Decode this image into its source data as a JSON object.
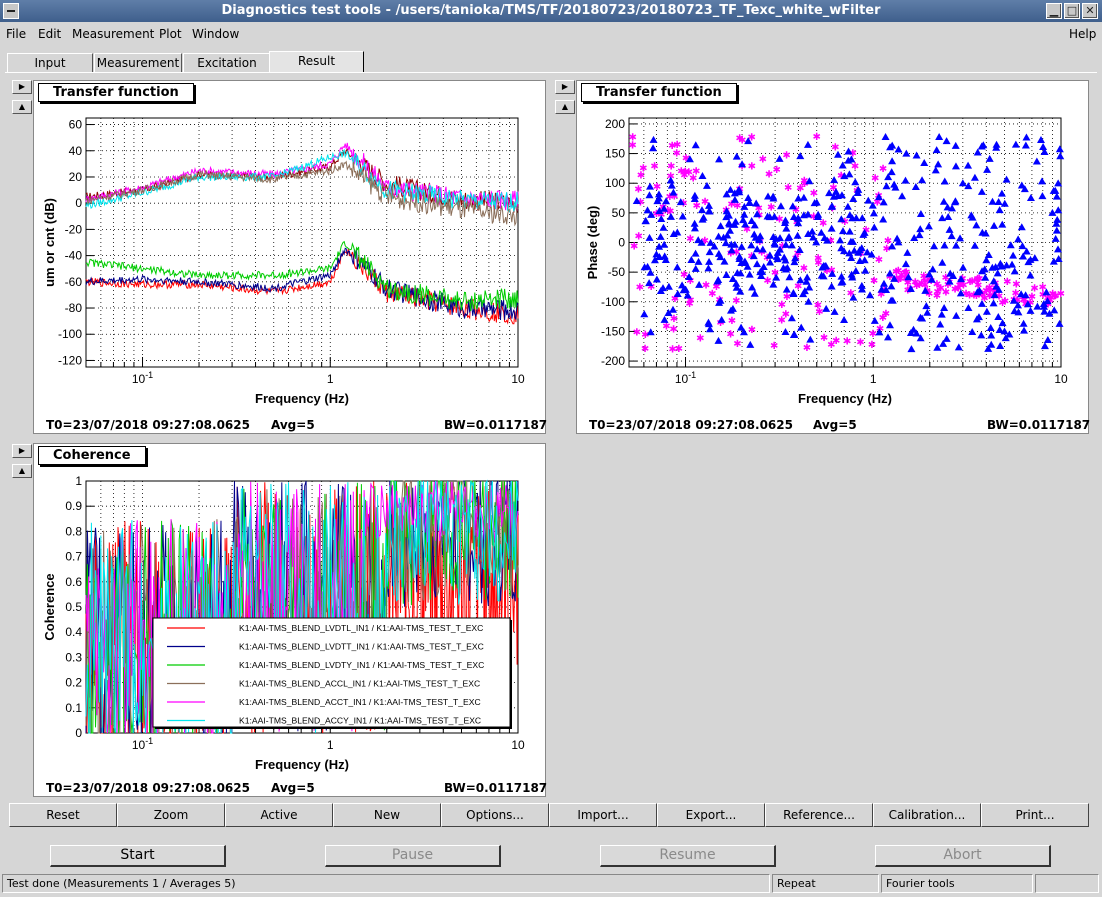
{
  "window": {
    "title": "Diagnostics test tools - /users/tanioka/TMS/TF/20180723/20180723_TF_Texc_white_wFilter"
  },
  "menu": [
    {
      "label": "File"
    },
    {
      "label": "Edit"
    },
    {
      "label": "Measurement"
    },
    {
      "label": "Plot"
    },
    {
      "label": "Window"
    },
    {
      "label": "Help"
    }
  ],
  "tabs": [
    {
      "label": "Input"
    },
    {
      "label": "Measurement"
    },
    {
      "label": "Excitation"
    },
    {
      "label": "Result",
      "active": true
    }
  ],
  "plots": {
    "tf_mag": {
      "title": "Transfer function",
      "t0": "T0=23/07/2018 09:27:08.0625",
      "avg": "Avg=5",
      "bw": "BW=0.0117187"
    },
    "tf_phase": {
      "title": "Transfer function",
      "t0": "T0=23/07/2018 09:27:08.0625",
      "avg": "Avg=5",
      "bw": "BW=0.0117187"
    },
    "coherence": {
      "title": "Coherence",
      "t0": "T0=23/07/2018 09:27:08.0625",
      "avg": "Avg=5",
      "bw": "BW=0.0117187"
    }
  },
  "chart_data": [
    {
      "type": "line",
      "title": "Transfer function",
      "xlabel": "Frequency (Hz)",
      "ylabel": "um or cnt (dB)",
      "xscale": "log",
      "xlim": [
        0.05,
        10
      ],
      "ylim": [
        -125,
        65
      ],
      "xticks": [
        "10^-1",
        "1",
        "10"
      ],
      "yticks": [
        60,
        40,
        20,
        0,
        -20,
        -40,
        -60,
        -80,
        -100,
        -120
      ],
      "grid": true,
      "series": [
        {
          "color": "#8b0000",
          "x": [
            0.05,
            0.1,
            0.2,
            0.5,
            1,
            1.2,
            2,
            5,
            10
          ],
          "y": [
            5,
            10,
            22,
            20,
            28,
            40,
            15,
            3,
            0
          ]
        },
        {
          "color": "#ff00ff",
          "x": [
            0.05,
            0.1,
            0.2,
            0.5,
            1,
            1.2,
            2,
            5,
            10
          ],
          "y": [
            3,
            12,
            25,
            22,
            30,
            45,
            12,
            4,
            2
          ]
        },
        {
          "color": "#00e5ee",
          "x": [
            0.05,
            0.1,
            0.2,
            0.5,
            1,
            1.2,
            2,
            5,
            10
          ],
          "y": [
            -2,
            8,
            20,
            20,
            35,
            38,
            10,
            2,
            1
          ]
        },
        {
          "color": "#8b6f5a",
          "x": [
            0.05,
            0.1,
            0.2,
            0.5,
            1,
            1.2,
            2,
            5,
            10
          ],
          "y": [
            2,
            10,
            22,
            18,
            25,
            30,
            5,
            -5,
            -10
          ]
        },
        {
          "color": "#ff0000",
          "x": [
            0.05,
            0.1,
            0.2,
            0.5,
            1,
            1.2,
            2,
            5,
            10
          ],
          "y": [
            -60,
            -62,
            -62,
            -68,
            -60,
            -35,
            -68,
            -80,
            -85
          ]
        },
        {
          "color": "#00008b",
          "x": [
            0.05,
            0.1,
            0.2,
            0.5,
            1,
            1.2,
            2,
            5,
            10
          ],
          "y": [
            -60,
            -58,
            -60,
            -65,
            -55,
            -35,
            -65,
            -80,
            -82
          ]
        },
        {
          "color": "#00cc00",
          "x": [
            0.05,
            0.1,
            0.2,
            0.5,
            1,
            1.2,
            2,
            5,
            10
          ],
          "y": [
            -45,
            -50,
            -55,
            -55,
            -50,
            -30,
            -65,
            -75,
            -72
          ]
        }
      ]
    },
    {
      "type": "scatter",
      "title": "Transfer function",
      "xlabel": "Frequency (Hz)",
      "ylabel": "Phase (deg)",
      "xscale": "log",
      "xlim": [
        0.05,
        10
      ],
      "ylim": [
        -210,
        210
      ],
      "xticks": [
        "10^-1",
        "1",
        "10"
      ],
      "yticks": [
        200,
        150,
        100,
        50,
        0,
        -50,
        -100,
        -150,
        -200
      ],
      "grid": true,
      "series": [
        {
          "color": "#ff00ff",
          "marker": "star",
          "x": [
            0.055,
            0.07,
            0.12,
            0.2,
            0.3,
            0.5,
            0.8,
            1.5,
            2.5,
            4,
            7
          ],
          "y": [
            -150,
            50,
            -160,
            130,
            -50,
            180,
            130,
            -60,
            -70,
            -80,
            -90
          ]
        },
        {
          "color": "#0000ff",
          "marker": "triangle",
          "x": [
            0.055,
            0.07,
            0.15,
            0.25,
            0.4,
            0.6,
            0.9,
            1.5,
            3,
            5,
            9
          ],
          "y": [
            70,
            -20,
            10,
            -50,
            40,
            60,
            -30,
            150,
            100,
            -150,
            50
          ]
        }
      ]
    },
    {
      "type": "line",
      "title": "Coherence",
      "xlabel": "Frequency (Hz)",
      "ylabel": "Coherence",
      "xscale": "log",
      "xlim": [
        0.05,
        10
      ],
      "ylim": [
        0,
        1
      ],
      "xticks": [
        "10^-1",
        "1",
        "10"
      ],
      "yticks": [
        1,
        0.9,
        0.8,
        0.7,
        0.6,
        0.5,
        0.4,
        0.3,
        0.2,
        0.1,
        0
      ],
      "grid": true,
      "legend_position": "bottom-right",
      "series": [
        {
          "name": "K1:AAI-TMS_BLEND_LVDTL_IN1 / K1:AAI-TMS_TEST_T_EXC",
          "color": "#ff0000"
        },
        {
          "name": "K1:AAI-TMS_BLEND_LVDTT_IN1 / K1:AAI-TMS_TEST_T_EXC",
          "color": "#00008b"
        },
        {
          "name": "K1:AAI-TMS_BLEND_LVDTY_IN1 / K1:AAI-TMS_TEST_T_EXC",
          "color": "#00cc00"
        },
        {
          "name": "K1:AAI-TMS_BLEND_ACCL_IN1 / K1:AAI-TMS_TEST_T_EXC",
          "color": "#8b6f5a"
        },
        {
          "name": "K1:AAI-TMS_BLEND_ACCT_IN1 / K1:AAI-TMS_TEST_T_EXC",
          "color": "#ff00ff"
        },
        {
          "name": "K1:AAI-TMS_BLEND_ACCY_IN1 / K1:AAI-TMS_TEST_T_EXC",
          "color": "#00e5ee"
        }
      ]
    }
  ],
  "toolbar": [
    {
      "label": "Reset"
    },
    {
      "label": "Zoom"
    },
    {
      "label": "Active"
    },
    {
      "label": "New"
    },
    {
      "label": "Options..."
    },
    {
      "label": "Import..."
    },
    {
      "label": "Export..."
    },
    {
      "label": "Reference..."
    },
    {
      "label": "Calibration..."
    },
    {
      "label": "Print..."
    }
  ],
  "controls": [
    {
      "label": "Start",
      "enabled": true
    },
    {
      "label": "Pause",
      "enabled": false
    },
    {
      "label": "Resume",
      "enabled": false
    },
    {
      "label": "Abort",
      "enabled": false
    }
  ],
  "status": {
    "message": "Test done (Measurements 1 / Averages 5)",
    "mode": "Repeat",
    "tool": "Fourier tools"
  }
}
